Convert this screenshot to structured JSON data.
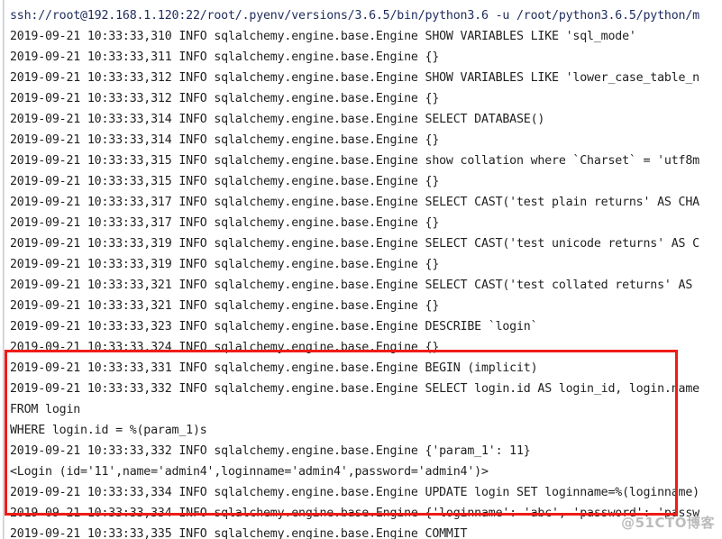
{
  "console": {
    "command_line": "ssh://root@192.168.1.120:22/root/.pyenv/versions/3.6.5/bin/python3.6 -u /root/python3.6.5/python/m",
    "lines": [
      "2019-09-21 10:33:33,310 INFO sqlalchemy.engine.base.Engine SHOW VARIABLES LIKE 'sql_mode'",
      "2019-09-21 10:33:33,311 INFO sqlalchemy.engine.base.Engine {}",
      "2019-09-21 10:33:33,312 INFO sqlalchemy.engine.base.Engine SHOW VARIABLES LIKE 'lower_case_table_n",
      "2019-09-21 10:33:33,312 INFO sqlalchemy.engine.base.Engine {}",
      "2019-09-21 10:33:33,314 INFO sqlalchemy.engine.base.Engine SELECT DATABASE()",
      "2019-09-21 10:33:33,314 INFO sqlalchemy.engine.base.Engine {}",
      "2019-09-21 10:33:33,315 INFO sqlalchemy.engine.base.Engine show collation where `Charset` = 'utf8m",
      "2019-09-21 10:33:33,315 INFO sqlalchemy.engine.base.Engine {}",
      "2019-09-21 10:33:33,317 INFO sqlalchemy.engine.base.Engine SELECT CAST('test plain returns' AS CHA",
      "2019-09-21 10:33:33,317 INFO sqlalchemy.engine.base.Engine {}",
      "2019-09-21 10:33:33,319 INFO sqlalchemy.engine.base.Engine SELECT CAST('test unicode returns' AS C",
      "2019-09-21 10:33:33,319 INFO sqlalchemy.engine.base.Engine {}",
      "2019-09-21 10:33:33,321 INFO sqlalchemy.engine.base.Engine SELECT CAST('test collated returns' AS ",
      "2019-09-21 10:33:33,321 INFO sqlalchemy.engine.base.Engine {}",
      "2019-09-21 10:33:33,323 INFO sqlalchemy.engine.base.Engine DESCRIBE `login`",
      "2019-09-21 10:33:33,324 INFO sqlalchemy.engine.base.Engine {}",
      "2019-09-21 10:33:33,331 INFO sqlalchemy.engine.base.Engine BEGIN (implicit)",
      "2019-09-21 10:33:33,332 INFO sqlalchemy.engine.base.Engine SELECT login.id AS login_id, login.name",
      "FROM login",
      "WHERE login.id = %(param_1)s",
      "2019-09-21 10:33:33,332 INFO sqlalchemy.engine.base.Engine {'param_1': 11}",
      "<Login (id='11',name='admin4',loginname='admin4',password='admin4')>",
      "2019-09-21 10:33:33,334 INFO sqlalchemy.engine.base.Engine UPDATE login SET loginname=%(loginname)",
      "2019-09-21 10:33:33,334 INFO sqlalchemy.engine.base.Engine {'loginname': 'abc', 'password': 'passw",
      "2019-09-21 10:33:33,335 INFO sqlalchemy.engine.base.Engine COMMIT"
    ]
  },
  "annotation": {
    "color": "#ee1c16",
    "label": "highlighted-log-region"
  },
  "watermark": {
    "text": "@51CTO博客"
  }
}
